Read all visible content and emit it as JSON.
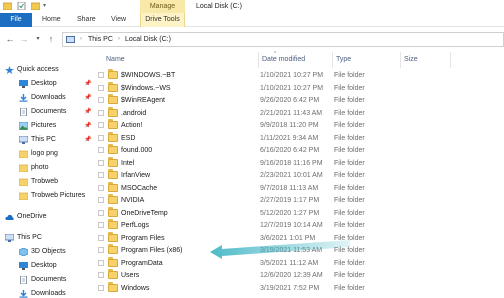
{
  "window": {
    "title": "Local Disk (C:)",
    "context_tab_group": "Manage"
  },
  "ribbon": {
    "tabs": [
      "File",
      "Home",
      "Share",
      "View",
      "Drive Tools"
    ]
  },
  "address": {
    "crumbs": [
      "This PC",
      "Local Disk (C:)"
    ]
  },
  "sidebar": {
    "items": [
      {
        "label": "Quick access",
        "icon": "star-icon",
        "pinned": false
      },
      {
        "label": "Desktop",
        "icon": "desktop-icon",
        "pinned": true
      },
      {
        "label": "Downloads",
        "icon": "downloads-icon",
        "pinned": true
      },
      {
        "label": "Documents",
        "icon": "documents-icon",
        "pinned": true
      },
      {
        "label": "Pictures",
        "icon": "pictures-icon",
        "pinned": true
      },
      {
        "label": "This PC",
        "icon": "pc-icon",
        "pinned": true
      },
      {
        "label": "logo png",
        "icon": "folder-icon",
        "pinned": false
      },
      {
        "label": "photo",
        "icon": "folder-icon",
        "pinned": false
      },
      {
        "label": "Trobweb",
        "icon": "folder-icon",
        "pinned": false
      },
      {
        "label": "Trobweb Pictures",
        "icon": "folder-icon",
        "pinned": false
      },
      {
        "label": "OneDrive",
        "icon": "cloud-icon",
        "pinned": false
      },
      {
        "label": "This PC",
        "icon": "pc-icon",
        "pinned": false
      },
      {
        "label": "3D Objects",
        "icon": "cube-icon",
        "pinned": false
      },
      {
        "label": "Desktop",
        "icon": "desktop-icon",
        "pinned": false
      },
      {
        "label": "Documents",
        "icon": "documents-icon",
        "pinned": false
      },
      {
        "label": "Downloads",
        "icon": "downloads-icon",
        "pinned": false
      }
    ]
  },
  "columns": [
    "Name",
    "Date modified",
    "Type",
    "Size"
  ],
  "files": [
    {
      "name": "$WINDOWS.~BT",
      "date": "1/10/2021 10:27 PM",
      "type": "File folder"
    },
    {
      "name": "$Windows.~WS",
      "date": "1/10/2021 10:27 PM",
      "type": "File folder"
    },
    {
      "name": "$WinREAgent",
      "date": "9/26/2020 6:42 PM",
      "type": "File folder"
    },
    {
      "name": ".android",
      "date": "2/21/2021 11:43 AM",
      "type": "File folder"
    },
    {
      "name": "Action!",
      "date": "9/9/2018 11:20 PM",
      "type": "File folder"
    },
    {
      "name": "ESD",
      "date": "1/11/2021 9:34 AM",
      "type": "File folder"
    },
    {
      "name": "found.000",
      "date": "6/16/2020 6:42 PM",
      "type": "File folder"
    },
    {
      "name": "Intel",
      "date": "9/16/2018 11:16 PM",
      "type": "File folder"
    },
    {
      "name": "IrfanView",
      "date": "2/23/2021 10:01 AM",
      "type": "File folder"
    },
    {
      "name": "MSOCache",
      "date": "9/7/2018 11:13 AM",
      "type": "File folder"
    },
    {
      "name": "NVIDIA",
      "date": "2/27/2019 1:17 PM",
      "type": "File folder"
    },
    {
      "name": "OneDriveTemp",
      "date": "5/12/2020 1:27 PM",
      "type": "File folder"
    },
    {
      "name": "PerfLogs",
      "date": "12/7/2019 10:14 AM",
      "type": "File folder"
    },
    {
      "name": "Program Files",
      "date": "3/6/2021 1:01 PM",
      "type": "File folder"
    },
    {
      "name": "Program Files (x86)",
      "date": "3/19/2021 11:53 AM",
      "type": "File folder"
    },
    {
      "name": "ProgramData",
      "date": "3/5/2021 11:12 AM",
      "type": "File folder"
    },
    {
      "name": "Users",
      "date": "12/6/2020 12:39 AM",
      "type": "File folder"
    },
    {
      "name": "Windows",
      "date": "3/19/2021 7:52 PM",
      "type": "File folder"
    }
  ],
  "colors": {
    "file_tab": "#1b6ec2",
    "manage_tab": "#f8e9a8",
    "folder": "#f7d26a",
    "annotation_arrow": "#3bb3c3"
  }
}
